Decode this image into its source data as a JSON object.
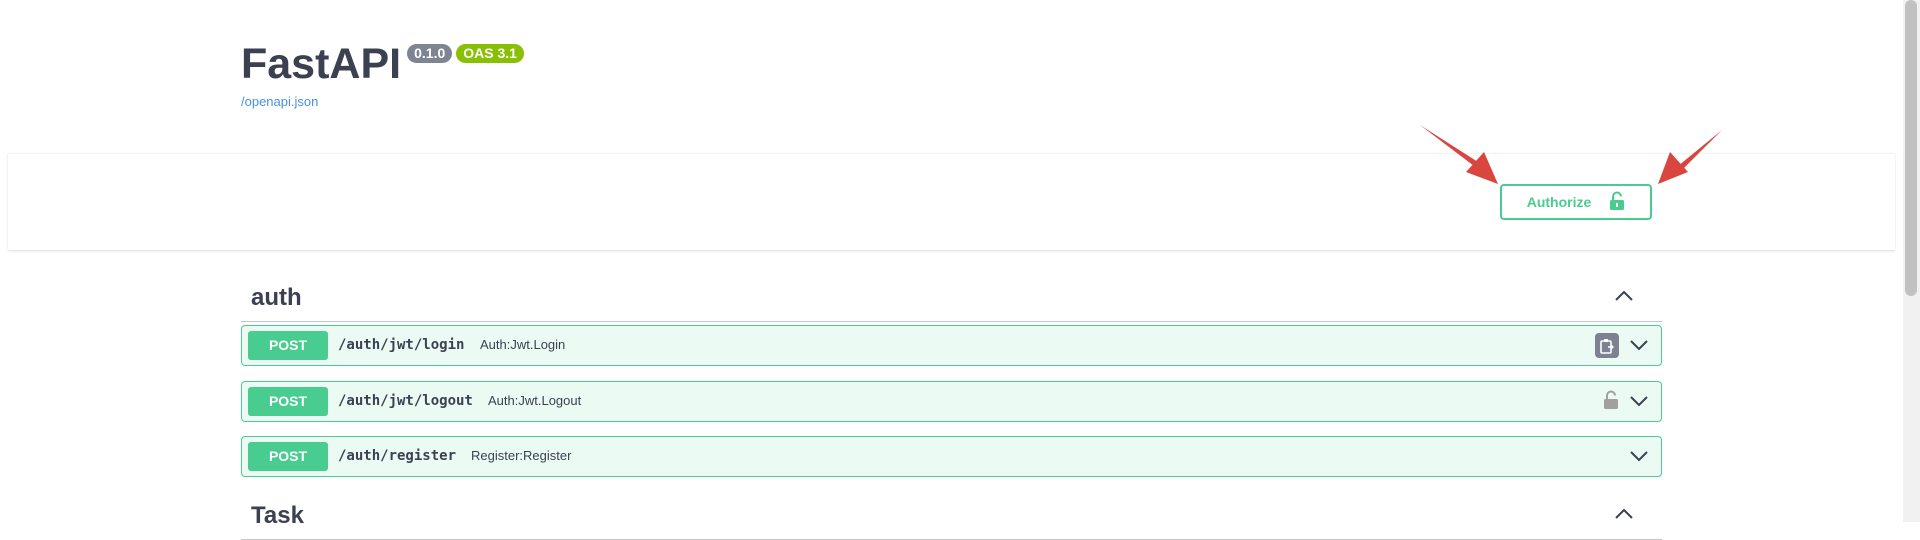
{
  "info": {
    "title": "FastAPI",
    "version_badge": "0.1.0",
    "oas_badge": "OAS 3.1",
    "spec_link": "/openapi.json"
  },
  "authorize": {
    "label": "Authorize",
    "icon": "unlocked-icon"
  },
  "colors": {
    "post": "#49cc90",
    "version_badge": "#7d8492",
    "oas_badge": "#89bf04",
    "link": "#4990e2",
    "annotation_arrow": "#d9463f"
  },
  "tags": [
    {
      "name": "auth",
      "expanded": true,
      "operations": [
        {
          "method": "POST",
          "path": "/auth/jwt/login",
          "summary": "Auth:Jwt.Login",
          "action_icon": "copy-icon"
        },
        {
          "method": "POST",
          "path": "/auth/jwt/logout",
          "summary": "Auth:Jwt.Logout",
          "action_icon": "lock-icon"
        },
        {
          "method": "POST",
          "path": "/auth/register",
          "summary": "Register:Register",
          "action_icon": ""
        }
      ]
    },
    {
      "name": "Task",
      "expanded": true,
      "operations": []
    }
  ]
}
